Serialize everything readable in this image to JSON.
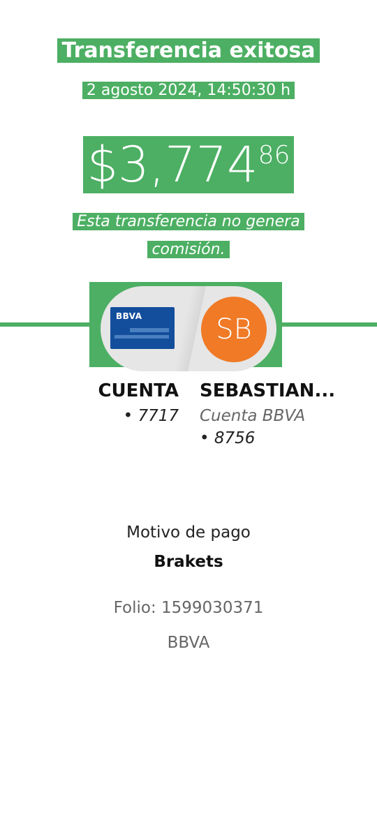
{
  "header": {
    "title": "Transferencia exitosa",
    "datetime": "2 agosto 2024, 14:50:30 h"
  },
  "amount": {
    "main": "$3,774",
    "cents": "86"
  },
  "note": "Esta transferencia no genera comisión.",
  "colors": {
    "accent_green": "#4caf63",
    "card_blue": "#134e9c",
    "avatar_orange": "#f07a26"
  },
  "origin": {
    "icon": "bank-card-icon",
    "card_brand": "BBVA",
    "name": "CUENTA",
    "number": "• 7717"
  },
  "destination": {
    "avatar_initials": "SB",
    "name": "SEBASTIAN...",
    "account_type": "Cuenta BBVA",
    "number": "• 8756"
  },
  "details": {
    "motive_label": "Motivo de pago",
    "motive_value": "Brakets",
    "folio": "Folio: 1599030371",
    "bank": "BBVA"
  }
}
